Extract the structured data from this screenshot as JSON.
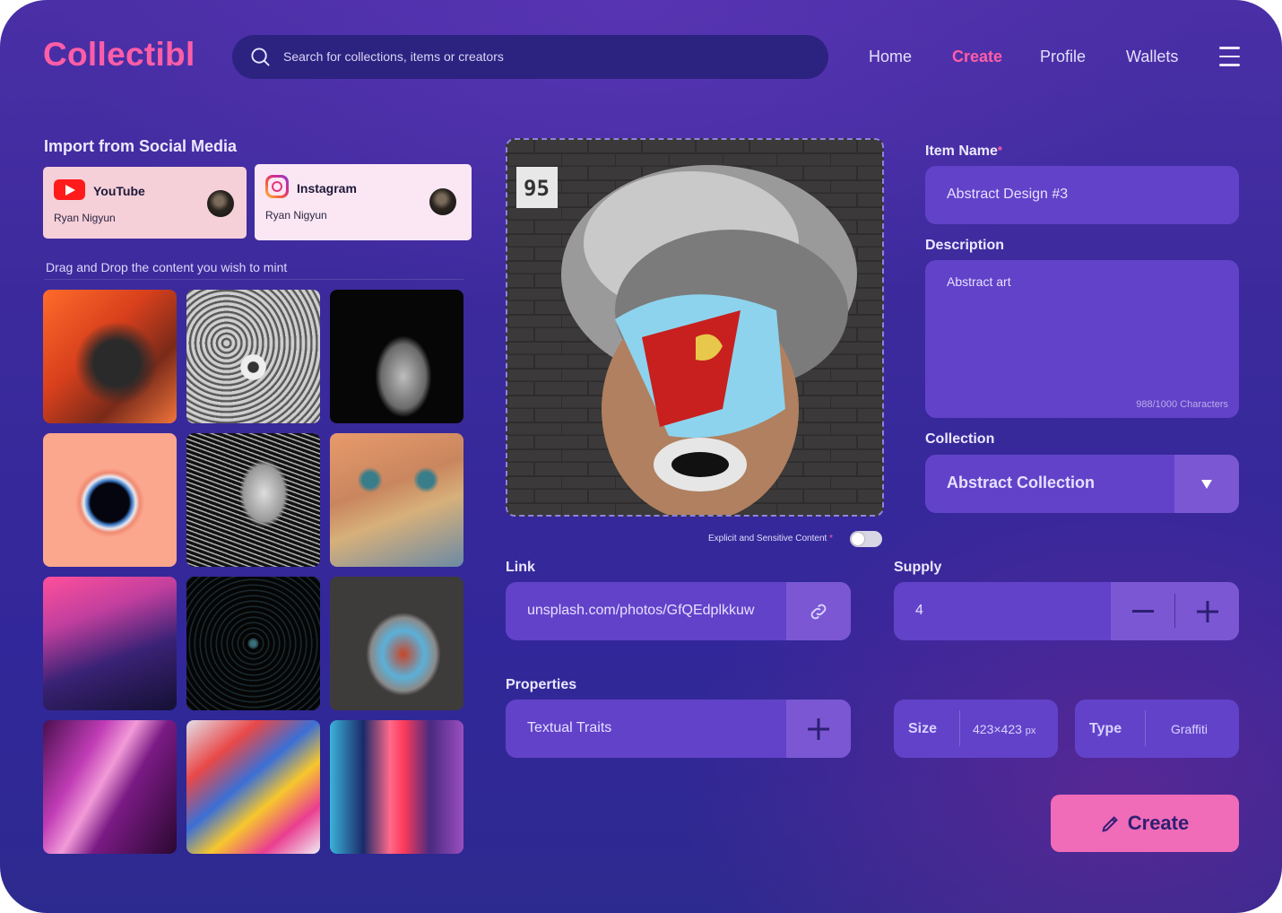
{
  "app": {
    "logo": "Collectibl"
  },
  "search": {
    "placeholder": "Search for collections, items or creators"
  },
  "nav": {
    "home": "Home",
    "create": "Create",
    "profile": "Profile",
    "wallets": "Wallets"
  },
  "import": {
    "title": "Import from Social Media",
    "youtube": {
      "name": "YouTube",
      "user": "Ryan Nigyun"
    },
    "instagram": {
      "name": "Instagram",
      "user": "Ryan Nigyun"
    },
    "drag_hint": "Drag and Drop the content you wish to mint"
  },
  "preview": {
    "badge": "95",
    "explicit_label": "Explicit and Sensitive Content",
    "required_mark": "*"
  },
  "form": {
    "item_name_label": "Item Name",
    "item_name_value": "Abstract Design #3",
    "required_mark": "*",
    "description_label": "Description",
    "description_value": "Abstract art",
    "description_counter": "988/1000 Characters",
    "collection_label": "Collection",
    "collection_value": "Abstract Collection",
    "link_label": "Link",
    "link_value": "unsplash.com/photos/GfQEdplkkuw",
    "supply_label": "Supply",
    "supply_value": "4",
    "properties_label": "Properties",
    "traits_value": "Textual Traits",
    "size_key": "Size",
    "size_value": "423×423",
    "size_unit": "px",
    "type_key": "Type",
    "type_value": "Graffiti",
    "create_button": "Create"
  },
  "colors": {
    "accent": "#ff5ea7",
    "field": "#6242c9",
    "button": "#f06bb8",
    "background": "#3b2a9c"
  }
}
